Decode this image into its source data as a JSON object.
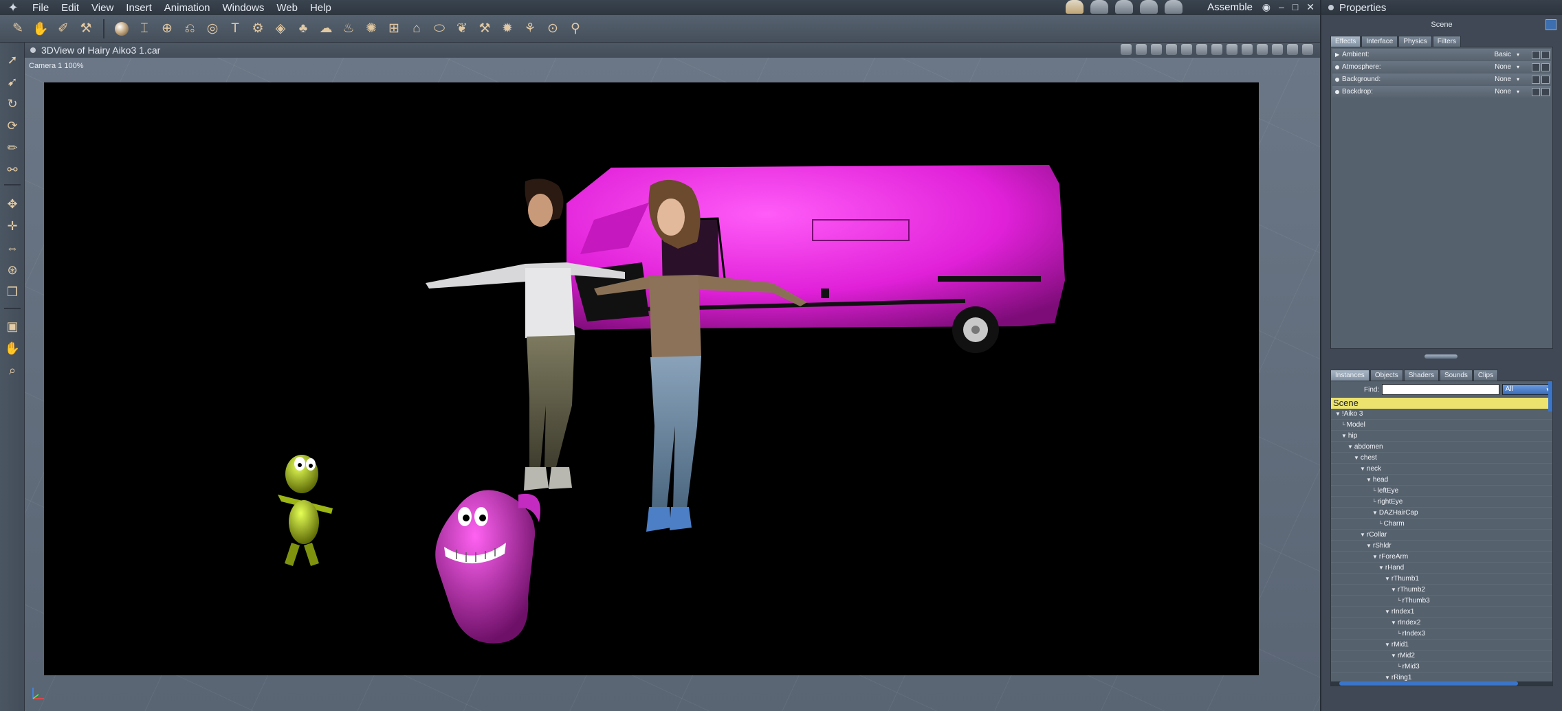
{
  "menubar": {
    "items": [
      "File",
      "Edit",
      "View",
      "Insert",
      "Animation",
      "Windows",
      "Web",
      "Help"
    ],
    "room_name": "Assemble",
    "room_icons": [
      "assemble-room-icon",
      "face-room-icon",
      "hair-room-icon",
      "cloth-room-icon",
      "content-room-icon"
    ]
  },
  "viewport": {
    "title": "3DView of Hairy Aiko3 1.car",
    "camera_label": "Camera 1 100%"
  },
  "properties": {
    "title": "Properties",
    "scene_label": "Scene",
    "tabs": [
      "Effects",
      "Interface",
      "Physics",
      "Filters"
    ],
    "active_tab": "Effects",
    "effects": [
      {
        "label": "Ambient:",
        "value": "Basic"
      },
      {
        "label": "Atmosphere:",
        "value": "None"
      },
      {
        "label": "Background:",
        "value": "None"
      },
      {
        "label": "Backdrop:",
        "value": "None"
      }
    ]
  },
  "browser": {
    "tabs": [
      "Instances",
      "Objects",
      "Shaders",
      "Sounds",
      "Clips"
    ],
    "active_tab": "Instances",
    "find_label": "Find:",
    "find_value": "",
    "filter_value": "All",
    "scene_root": "Scene",
    "tree": [
      {
        "label": "!Aiko 3",
        "depth": 0,
        "expanded": true
      },
      {
        "label": "Model",
        "depth": 1,
        "expanded": false
      },
      {
        "label": "hip",
        "depth": 1,
        "expanded": true
      },
      {
        "label": "abdomen",
        "depth": 2,
        "expanded": true
      },
      {
        "label": "chest",
        "depth": 3,
        "expanded": true
      },
      {
        "label": "neck",
        "depth": 4,
        "expanded": true
      },
      {
        "label": "head",
        "depth": 5,
        "expanded": true
      },
      {
        "label": "leftEye",
        "depth": 6,
        "expanded": false
      },
      {
        "label": "rightEye",
        "depth": 6,
        "expanded": false
      },
      {
        "label": "DAZHairCap",
        "depth": 6,
        "expanded": true
      },
      {
        "label": "Charm",
        "depth": 7,
        "expanded": false
      },
      {
        "label": "rCollar",
        "depth": 4,
        "expanded": true
      },
      {
        "label": "rShldr",
        "depth": 5,
        "expanded": true
      },
      {
        "label": "rForeArm",
        "depth": 6,
        "expanded": true
      },
      {
        "label": "rHand",
        "depth": 7,
        "expanded": true
      },
      {
        "label": "rThumb1",
        "depth": 8,
        "expanded": true
      },
      {
        "label": "rThumb2",
        "depth": 9,
        "expanded": true
      },
      {
        "label": "rThumb3",
        "depth": 10,
        "expanded": false
      },
      {
        "label": "rIndex1",
        "depth": 8,
        "expanded": true
      },
      {
        "label": "rIndex2",
        "depth": 9,
        "expanded": true
      },
      {
        "label": "rIndex3",
        "depth": 10,
        "expanded": false
      },
      {
        "label": "rMid1",
        "depth": 8,
        "expanded": true
      },
      {
        "label": "rMid2",
        "depth": 9,
        "expanded": true
      },
      {
        "label": "rMid3",
        "depth": 10,
        "expanded": false
      },
      {
        "label": "rRing1",
        "depth": 8,
        "expanded": true
      }
    ]
  },
  "colors": {
    "van": "#e020d8",
    "alien": "#a8c418",
    "monster": "#c42bc0",
    "scene_bar": "#ece36e",
    "selection_blue": "#3a75c9"
  }
}
